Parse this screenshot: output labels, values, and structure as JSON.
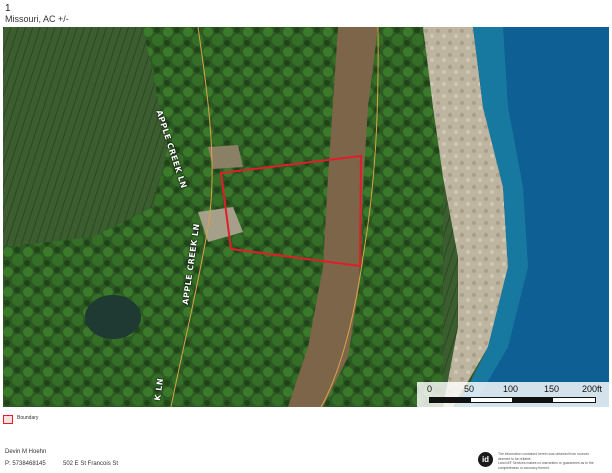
{
  "page": {
    "number": "1",
    "title": "Missouri,  AC +/-"
  },
  "map": {
    "type": "aerial-parcel",
    "road_labels": [
      "APPLE CREEK LN",
      "APPLE CREEK LN",
      "K LN"
    ],
    "boundary_color": "#e11d2a",
    "road_line_color": "#d9a449",
    "water_color": "#0e5f93",
    "scale": {
      "labels": [
        "0",
        "50",
        "100",
        "150",
        "200ft"
      ]
    }
  },
  "legend": {
    "items": [
      {
        "label": "Boundary",
        "icon": "boundary-swatch-icon",
        "color": "#e11d2a"
      }
    ]
  },
  "agent": {
    "name": "Devin M Hoehn",
    "phone": "P: 5738468145",
    "address": "502 E St Francois St"
  },
  "footer": {
    "logo_text": "id",
    "disclaimer_lines": [
      "The information contained herein was obtained from sources",
      "deemed to be reliable.",
      "Land id® Services makes no warranties or guarantees as to the",
      "completeness or accuracy thereof."
    ]
  }
}
